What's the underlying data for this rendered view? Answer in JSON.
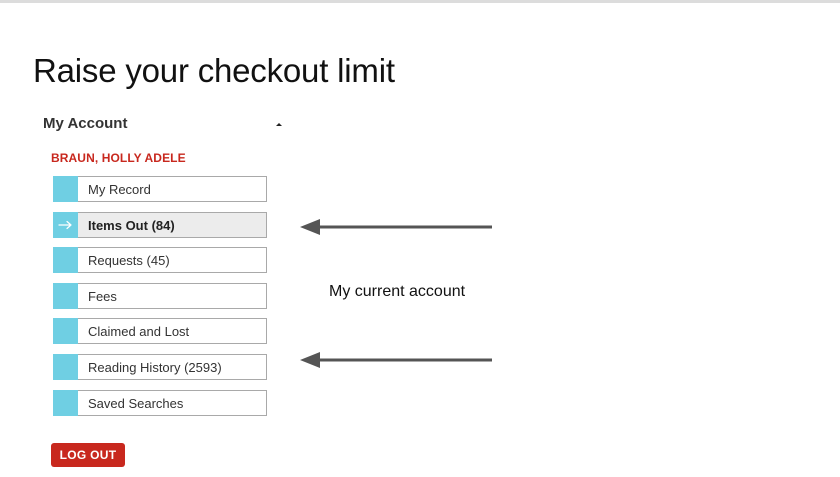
{
  "page": {
    "title": "Raise your checkout limit"
  },
  "account": {
    "title": "My Account",
    "toggle_icon": "caret-up-icon",
    "patron_name": "BRAUN, HOLLY ADELE",
    "nav_items": [
      {
        "label": "My Record",
        "active": false
      },
      {
        "label": "Items Out (84)",
        "active": true
      },
      {
        "label": "Requests (45)",
        "active": false
      },
      {
        "label": "Fees",
        "active": false
      },
      {
        "label": "Claimed and Lost",
        "active": false
      },
      {
        "label": "Reading History (2593)",
        "active": false
      },
      {
        "label": "Saved Searches",
        "active": false
      }
    ],
    "logout_label": "LOG OUT"
  },
  "annotation": {
    "text": "My current account",
    "arrow_icon": "arrow-left-icon"
  },
  "colors": {
    "accent_red": "#c8281e",
    "nav_swatch": "#6fcfe3",
    "active_bg": "#ececec",
    "arrow": "#555555"
  }
}
